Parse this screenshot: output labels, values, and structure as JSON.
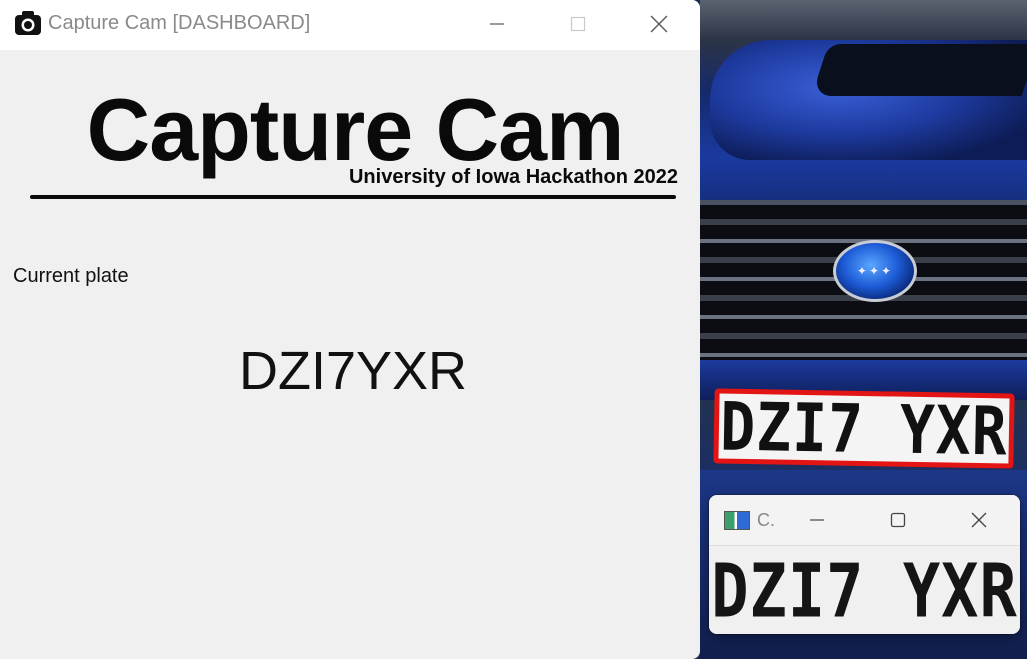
{
  "main_window": {
    "title": "Capture Cam [DASHBOARD]",
    "logo": {
      "title": "Capture Cam",
      "subtitle": "University of Iowa Hackathon 2022"
    },
    "current_plate_label": "Current plate",
    "current_plate_value": "DZI7YXR"
  },
  "camera_feed": {
    "detected_plate_text": "DZI7 YXR",
    "highlight_color": "#e31414"
  },
  "crop_window": {
    "title": "C.",
    "plate_text": "DZI7 YXR"
  },
  "icons": {
    "main_app": "camera-icon",
    "crop_app": "image-viewer-icon"
  }
}
